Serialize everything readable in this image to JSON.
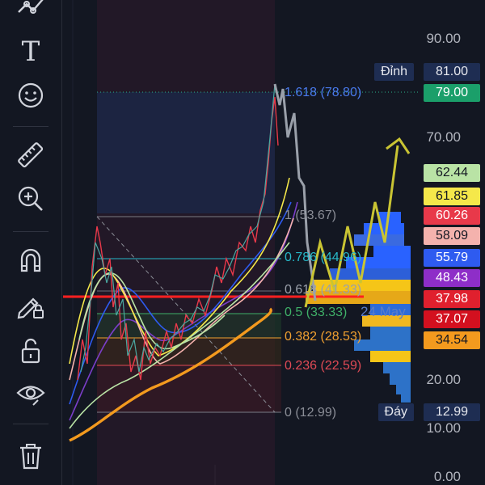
{
  "toolbar": {
    "tools": [
      {
        "name": "trend-line-tool",
        "icon": "trend-line-icon"
      },
      {
        "name": "text-tool",
        "icon": "text-icon",
        "glyph": "T"
      },
      {
        "name": "emoji-tool",
        "icon": "smiley-icon"
      },
      {
        "name": "ruler-tool",
        "icon": "ruler-icon"
      },
      {
        "name": "zoom-tool",
        "icon": "zoom-in-icon"
      },
      {
        "name": "magnet-tool",
        "icon": "magnet-icon"
      },
      {
        "name": "lock-drawings-tool",
        "icon": "pencil-lock-icon"
      },
      {
        "name": "unlock-tool",
        "icon": "unlock-icon"
      },
      {
        "name": "visibility-tool",
        "icon": "eye-icon"
      },
      {
        "name": "delete-tool",
        "icon": "trash-icon"
      }
    ]
  },
  "price_axis": {
    "labels": [
      "90.00",
      "70.00",
      "20.00",
      "10.00",
      "0.00"
    ]
  },
  "price_markers": {
    "high_label": "Đỉnh",
    "high_value": "81.00",
    "low_label": "Đáy",
    "low_value": "12.99",
    "current_value": "79.00"
  },
  "fib_levels": [
    {
      "text": "1.618 (78.80)",
      "color": "#4a7cf0"
    },
    {
      "text": "1 (53.67)",
      "color": "#8a8d96"
    },
    {
      "text": "0.786 (44.96)",
      "color": "#27b9c9"
    },
    {
      "text": "0.618 (41.33)",
      "color": "#9aa0aa"
    },
    {
      "text": "0.5 (33.33)",
      "color": "#3fb068"
    },
    {
      "text": "0.382 (28.53)",
      "color": "#f0a030"
    },
    {
      "text": "0.236 (22.59)",
      "color": "#e04a55"
    },
    {
      "text": "0 (12.99)",
      "color": "#8a8d96"
    }
  ],
  "date_label": "24 May",
  "indicator_badges": [
    {
      "value": "62.44",
      "bg": "#b9e3a5",
      "fg": "#131722"
    },
    {
      "value": "61.85",
      "bg": "#f5e84a",
      "fg": "#131722"
    },
    {
      "value": "60.26",
      "bg": "#e8394a",
      "fg": "#ffffff"
    },
    {
      "value": "58.09",
      "bg": "#f4b2ad",
      "fg": "#131722"
    },
    {
      "value": "55.79",
      "bg": "#2e5bf0",
      "fg": "#ffffff"
    },
    {
      "value": "48.43",
      "bg": "#8e2ec8",
      "fg": "#ffffff"
    },
    {
      "value": "37.98",
      "bg": "#e0202e",
      "fg": "#ffffff"
    },
    {
      "value": "37.07",
      "bg": "#d3101f",
      "fg": "#ffffff"
    },
    {
      "value": "34.54",
      "bg": "#f39a1e",
      "fg": "#131722"
    }
  ],
  "colors": {
    "background": "#131722",
    "current_price": "#1b9f6a",
    "high_badge": "#1e2d52",
    "support_line": "#f39a1e",
    "resistance_line": "#ff2020",
    "projection": "#c9c433"
  }
}
